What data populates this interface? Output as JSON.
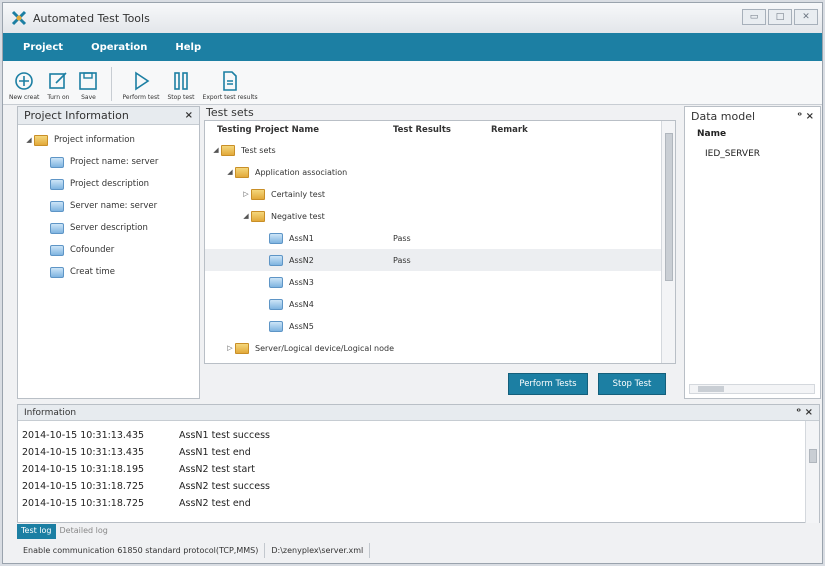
{
  "window": {
    "title": "Automated Test Tools",
    "icon": "app-logo-icon"
  },
  "menu": [
    "Project",
    "Operation",
    "Help"
  ],
  "toolbar": {
    "group1": [
      {
        "label": "New creat",
        "icon": "plus-circle-icon"
      },
      {
        "label": "Turn on",
        "icon": "open-edit-icon"
      },
      {
        "label": "Save",
        "icon": "save-icon"
      }
    ],
    "group2": [
      {
        "label": "Perform test",
        "icon": "play-icon"
      },
      {
        "label": "Stop test",
        "icon": "pause-icon"
      },
      {
        "label": "Export test results",
        "icon": "export-document-icon"
      }
    ]
  },
  "project_panel": {
    "title": "Project Information",
    "close": "×",
    "root": "Project information",
    "items": [
      "Project name: server",
      "Project description",
      "Server name: server",
      "Server description",
      "Cofounder",
      "Creat time"
    ]
  },
  "test_panel": {
    "tab": "Test sets",
    "columns": [
      "Testing Project Name",
      "Test Results",
      "Remark"
    ],
    "rows": [
      {
        "name": "Test sets",
        "result": ""
      },
      {
        "name": "Application association",
        "result": ""
      },
      {
        "name": "Certainly test",
        "result": ""
      },
      {
        "name": "Negative test",
        "result": ""
      },
      {
        "name": "AssN1",
        "result": "Pass"
      },
      {
        "name": "AssN2",
        "result": "Pass"
      },
      {
        "name": "AssN3",
        "result": ""
      },
      {
        "name": "AssN4",
        "result": ""
      },
      {
        "name": "AssN5",
        "result": ""
      },
      {
        "name": "Server/Logical device/Logical node",
        "result": ""
      }
    ],
    "perform_button": "Perform Tests",
    "stop_button": "Stop Test"
  },
  "data_model": {
    "title": "Data model",
    "ctrls": "ᵒ ×",
    "column": "Name",
    "items": [
      "IED_SERVER"
    ]
  },
  "information": {
    "title": "Information",
    "ctrls": "ᵒ ×",
    "log": [
      {
        "time": "2014-10-15 10:31:13.435",
        "msg": "AssN1 test success"
      },
      {
        "time": "2014-10-15 10:31:13.435",
        "msg": "AssN1 test end"
      },
      {
        "time": "2014-10-15 10:31:18.195",
        "msg": "AssN2 test start"
      },
      {
        "time": "2014-10-15 10:31:18.725",
        "msg": "AssN2 test success"
      },
      {
        "time": "2014-10-15 10:31:18.725",
        "msg": "AssN2 test end"
      }
    ]
  },
  "bottom_tabs": [
    "Test log",
    "Detailed log"
  ],
  "status": [
    "Enable communication 61850 standard protocol(TCP,MMS)",
    "D:\\zenyplex\\server.xml"
  ],
  "colors": {
    "accent": "#1c7fa3",
    "folder": "#e2a93a",
    "item": "#7fb4e0"
  }
}
